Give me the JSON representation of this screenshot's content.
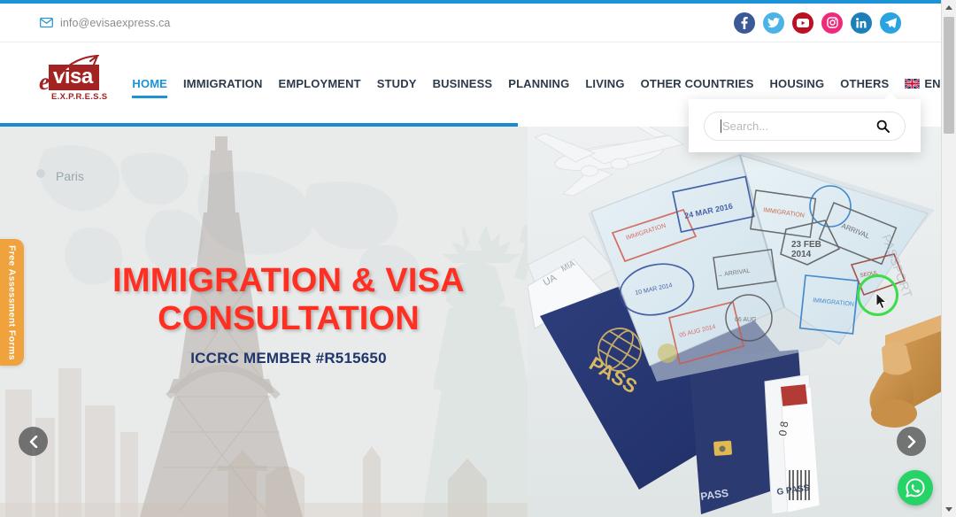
{
  "topbar": {
    "email": "info@evisaexpress.ca",
    "email_icon": "envelope-icon",
    "socials": [
      {
        "name": "facebook",
        "glyph": "f",
        "color": "#3b5998"
      },
      {
        "name": "twitter",
        "glyph": "t",
        "color": "#4cb3e8"
      },
      {
        "name": "youtube",
        "glyph": "y",
        "color": "#bb1122"
      },
      {
        "name": "instagram",
        "glyph": "i",
        "color": "#ee2a7b"
      },
      {
        "name": "linkedin",
        "glyph": "in",
        "color": "#1d7fb8"
      },
      {
        "name": "telegram",
        "glyph": "tg",
        "color": "#2aa3e0"
      }
    ]
  },
  "brand": {
    "prefix": "e",
    "word": "visa",
    "tagline": "E.X.P.R.E.S.S"
  },
  "nav": {
    "items": [
      {
        "label": "HOME",
        "active": true
      },
      {
        "label": "IMMIGRATION",
        "active": false
      },
      {
        "label": "EMPLOYMENT",
        "active": false
      },
      {
        "label": "STUDY",
        "active": false
      },
      {
        "label": "BUSINESS",
        "active": false
      },
      {
        "label": "PLANNING",
        "active": false
      },
      {
        "label": "LIVING",
        "active": false
      },
      {
        "label": "OTHER COUNTRIES",
        "active": false
      },
      {
        "label": "HOUSING",
        "active": false
      },
      {
        "label": "OTHERS",
        "active": false
      },
      {
        "label": "ENGLISH",
        "active": false,
        "icon": "uk-flag-icon"
      }
    ],
    "search_icon": "search-icon",
    "accent_color": "#1b93d6"
  },
  "search_popup": {
    "placeholder": "Search...",
    "value": "",
    "submit_icon": "search-icon"
  },
  "progress": {
    "percent": 55,
    "color": "#1b8ad3"
  },
  "hero": {
    "title_line1": "IMMIGRATION & VISA",
    "title_line2": "CONSULTATION",
    "subtitle": "ICCRC MEMBER #R515650",
    "title_color": "#ff2f21",
    "subtitle_color": "#20356b",
    "map_label": "Paris",
    "prev_label": "Previous slide",
    "next_label": "Next slide"
  },
  "side_tab": {
    "label": "Free Assessment Forms",
    "color": "#f0a33c"
  },
  "whatsapp": {
    "label": "WhatsApp",
    "color": "#25d366"
  },
  "scrollbar": {
    "up_icon": "chevron-up-icon",
    "down_icon": "chevron-down-icon"
  }
}
